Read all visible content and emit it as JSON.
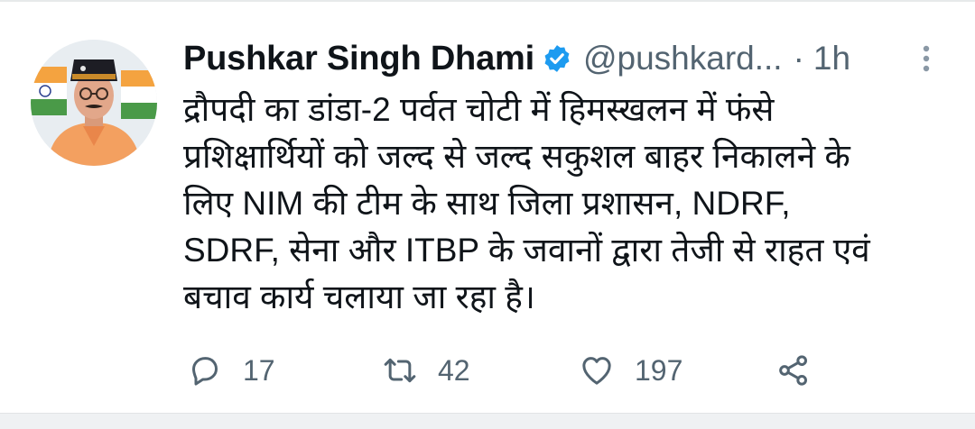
{
  "tweet": {
    "author_name": "Pushkar Singh Dhami",
    "handle": "@pushkard...",
    "separator": "·",
    "time": "1h",
    "text_lines": [
      "द्रौपदी का डांडा-2 पर्वत चोटी में हिमस्खलन में फंसे",
      "प्रशिक्षार्थियों को जल्द से जल्द सकुशल बाहर निकालने के",
      "लिए NIM की टीम के साथ जिला प्रशासन, NDRF,",
      "SDRF, सेना और ITBP के जवानों द्वारा तेजी से राहत एवं",
      "बचाव कार्य चलाया जा रहा है।"
    ]
  },
  "actions": {
    "reply_count": "17",
    "retweet_count": "42",
    "like_count": "197"
  },
  "icons": {
    "verified": "verified-badge-icon",
    "more": "more-vertical-icon",
    "reply": "reply-icon",
    "retweet": "retweet-icon",
    "like": "heart-icon",
    "share": "share-icon"
  },
  "colors": {
    "text": "#0f1419",
    "secondary": "#536471",
    "verified": "#1d9bf0"
  }
}
